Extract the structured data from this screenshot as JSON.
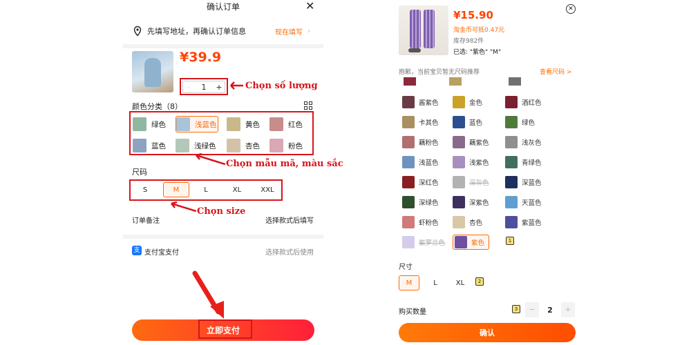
{
  "left": {
    "title": "确认订单",
    "address_text": "先填写地址，再确认订单信息",
    "address_action": "现在填写",
    "price": "¥39.9",
    "quantity": "1",
    "qty_minus": "-",
    "qty_plus": "+",
    "color_heading": "颜色分类（8）",
    "colors": [
      {
        "label": "绿色",
        "swatch": "#8fb7a2"
      },
      {
        "label": "浅蓝色",
        "swatch": "#a9c3d8",
        "selected": true
      },
      {
        "label": "黄色",
        "swatch": "#c9b98a"
      },
      {
        "label": "红色",
        "swatch": "#c98c8c"
      },
      {
        "label": "蓝色",
        "swatch": "#8ea3c2"
      },
      {
        "label": "浅绿色",
        "swatch": "#b3c8b8"
      },
      {
        "label": "杏色",
        "swatch": "#d4c2a8"
      },
      {
        "label": "粉色",
        "swatch": "#d9a8b5"
      }
    ],
    "size_heading": "尺码",
    "sizes": [
      "S",
      "M",
      "L",
      "XL",
      "XXL"
    ],
    "selected_size": "M",
    "remark_label": "订单备注",
    "remark_value": "选择款式后填写",
    "pay_label": "支付宝支付",
    "pay_value": "选择款式后使用",
    "pay_button": "立即支付",
    "annotation_quantity": "Chọn số lượng",
    "annotation_color": "Chọn mẫu mã, màu sắc",
    "annotation_size": "Chọn size"
  },
  "right": {
    "price": "¥15.90",
    "coin_text": "淘金币可抵0.47元",
    "stock_text": "库存982件",
    "selected_text": "已选: \"紫色\" \"M\"",
    "size_chart_note": "抱歉，当前宝贝暂无尺码推荐",
    "size_chart_link": "查看尺码 >",
    "colors": [
      {
        "label": "酱紫色",
        "swatch": "#6b3b45"
      },
      {
        "label": "金色",
        "swatch": "#c9a227"
      },
      {
        "label": "酒红色",
        "swatch": "#7a2030"
      },
      {
        "label": "卡其色",
        "swatch": "#a89060"
      },
      {
        "label": "蓝色",
        "swatch": "#2c4f8f"
      },
      {
        "label": "绿色",
        "swatch": "#4f7a3a"
      },
      {
        "label": "藕粉色",
        "swatch": "#b07070"
      },
      {
        "label": "藕紫色",
        "swatch": "#8a6a8a"
      },
      {
        "label": "浅灰色",
        "swatch": "#8f8f8f"
      },
      {
        "label": "浅蓝色",
        "swatch": "#6f93bf"
      },
      {
        "label": "浅紫色",
        "swatch": "#a88fc0"
      },
      {
        "label": "青绿色",
        "swatch": "#3f6f5f"
      },
      {
        "label": "深红色",
        "swatch": "#8a2020"
      },
      {
        "label": "深灰色",
        "swatch": "#555555",
        "disabled": true
      },
      {
        "label": "深蓝色",
        "swatch": "#1f2f5f"
      },
      {
        "label": "深绿色",
        "swatch": "#2f4f2f"
      },
      {
        "label": "深紫色",
        "swatch": "#3f2f5f"
      },
      {
        "label": "天蓝色",
        "swatch": "#5f9fcf"
      },
      {
        "label": "虾粉色",
        "swatch": "#d07a7a"
      },
      {
        "label": "杏色",
        "swatch": "#d8c8a8"
      },
      {
        "label": "紫蓝色",
        "swatch": "#4f4f9f"
      },
      {
        "label": "紫罗兰色",
        "swatch": "#9f8fcf",
        "disabled": true
      },
      {
        "label": "紫色",
        "swatch": "#6f4f9f",
        "selected": true
      }
    ],
    "color_note_badge": "1",
    "size_heading": "尺寸",
    "sizes": [
      "M",
      "L",
      "XL"
    ],
    "selected_size": "M",
    "size_note_badge": "2",
    "qty_label": "购买数量",
    "qty_note_badge": "3",
    "qty_minus": "−",
    "qty_value": "2",
    "qty_plus": "+",
    "confirm_button": "确认"
  },
  "colors": {
    "accent_orange": "#ff5000",
    "annotation_red": "#d7141a",
    "price_red": "#ff4400"
  }
}
